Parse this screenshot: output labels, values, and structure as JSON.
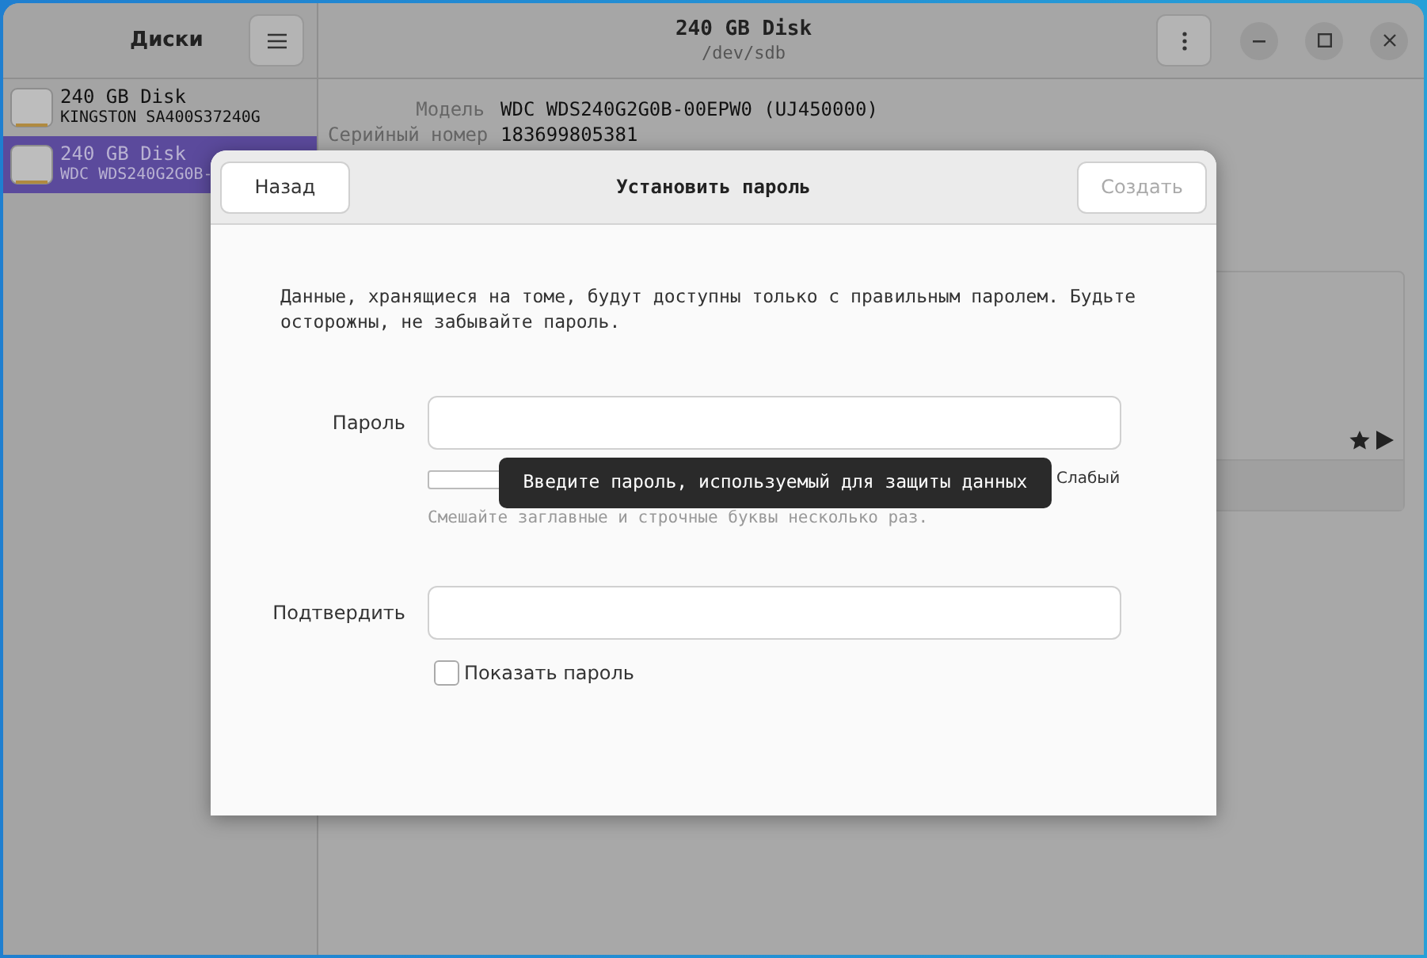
{
  "sidebar": {
    "title": "Диски",
    "items": [
      {
        "name": "240 GB Disk",
        "model": "KINGSTON SA400S37240G",
        "selected": false
      },
      {
        "name": "240 GB Disk",
        "model": "WDC WDS240G2G0B-",
        "selected": true
      }
    ]
  },
  "header": {
    "title": "240 GB Disk",
    "subtitle": "/dev/sdb"
  },
  "details": [
    {
      "label": "Модель",
      "value": "WDC WDS240G2G0B-00EPW0 (UJ450000)"
    },
    {
      "label": "Серийный номер",
      "value": "183699805381"
    }
  ],
  "dialog": {
    "title": "Установить пароль",
    "back_button": "Назад",
    "create_button": {
      "label": "Создать",
      "disabled": true
    },
    "message": "Данные, хранящиеся на томе, будут доступны только с правильным паролем. Будьте осторожны, не забывайте пароль.",
    "password": {
      "label": "Пароль"
    },
    "strength": {
      "level": 0,
      "reading": "Слабый"
    },
    "hint": "Смешайте заглавные и строчные буквы несколько раз.",
    "confirm": {
      "label": "Подтвердить"
    },
    "show_password": {
      "label": "Показать пароль",
      "checked": false
    },
    "tooltip": "Введите пароль, используемый для защиты данных"
  }
}
